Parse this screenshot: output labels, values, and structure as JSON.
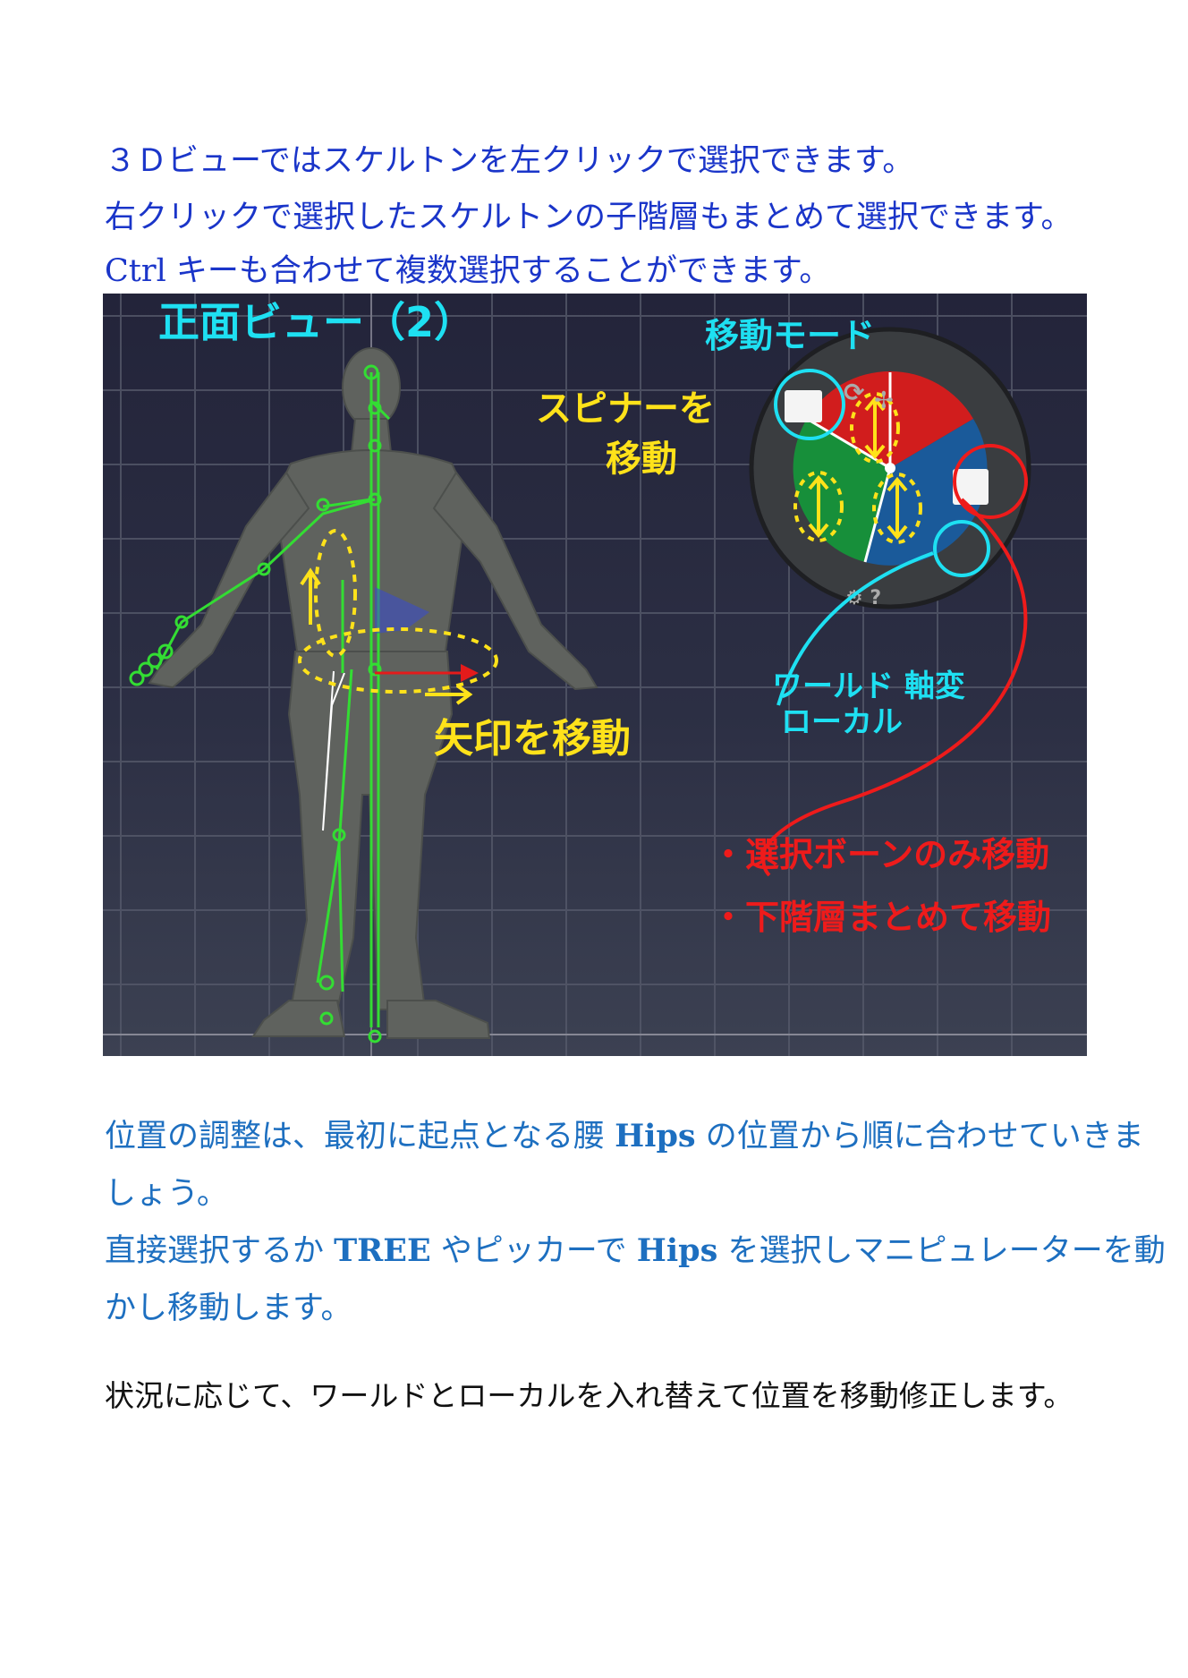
{
  "intro": {
    "line1": "３Ｄビューではスケルトンを左クリックで選択できます。",
    "line2": "右クリックで選択したスケルトンの子階層もまとめて選択できます。",
    "line3_key": "Ctrl",
    "line3_rest": " キーも合わせて複数選択することができます。"
  },
  "viewport": {
    "label_front_view": "正面ビュー（2）",
    "label_move_mode": "移動モード",
    "label_spinner_1": "スピナーを",
    "label_spinner_2": "移動",
    "label_arrow": "矢印を移動",
    "label_world_1": "ワールド 軸変",
    "label_world_2": "ローカル",
    "label_bone_only": "・選択ボーンのみ移動",
    "label_hierarchy": "・下階層まとめて移動",
    "colors": {
      "cyan": "#1ee0f2",
      "yellow": "#ffe21a",
      "red": "#ee1b1b",
      "bone": "#33dd33"
    }
  },
  "para1": {
    "p1": "位置の調整は、最初に起点となる腰 ",
    "hips": "Hips",
    "p2": " の位置から順に合わせていきま",
    "p3": "しょう。"
  },
  "para2": {
    "p1": "直接選択するか ",
    "tree": "TREE",
    "p2": " やピッカーで ",
    "hips": "Hips",
    "p3": " を選択しマニピュレーターを動",
    "p4": "かし移動します。"
  },
  "para3": {
    "text": "状況に応じて、ワールドとローカルを入れ替えて位置を移動修正します。"
  }
}
